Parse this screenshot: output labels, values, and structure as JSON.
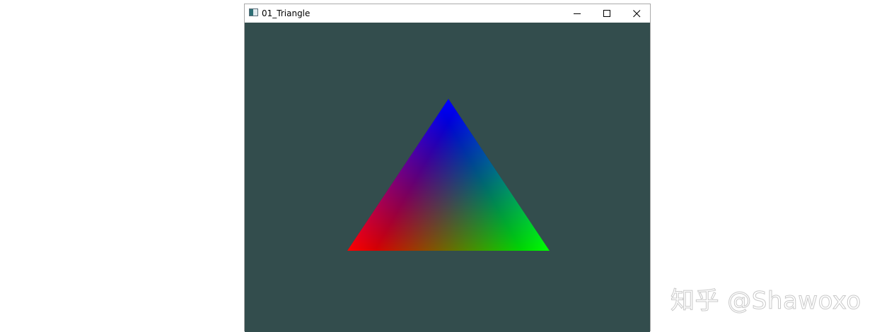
{
  "window": {
    "title": "01_Triangle",
    "controls": {
      "minimize_icon": "minimize-icon",
      "maximize_icon": "maximize-icon",
      "close_icon": "close-icon"
    }
  },
  "scene": {
    "clear_color": "#334d4d",
    "vertex_colors": {
      "bottom_left": "#ff0000",
      "bottom_right": "#00ff00",
      "top": "#0000ff"
    }
  },
  "watermark": {
    "text": "知乎 @Shawoxo"
  }
}
